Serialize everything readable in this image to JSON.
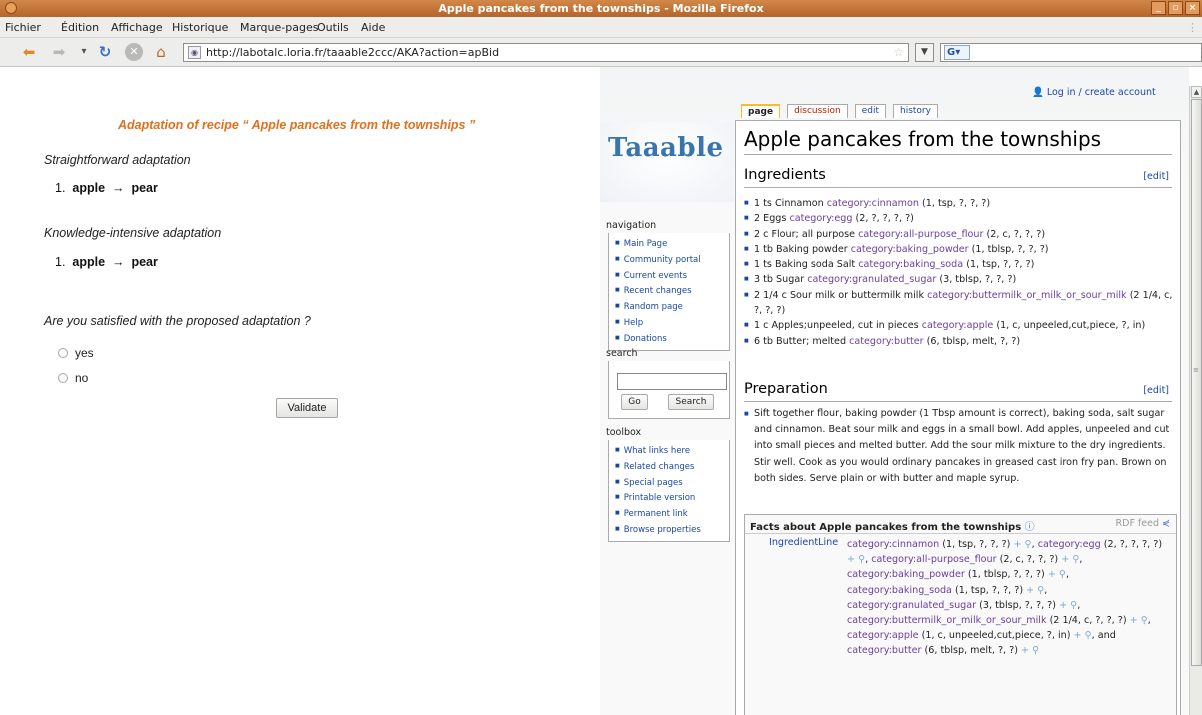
{
  "window": {
    "title": "Apple pancakes from the townships - Mozilla Firefox",
    "min": "_",
    "max": "▫",
    "close": "×"
  },
  "menu": [
    "Fichier",
    "Édition",
    "Affichage",
    "Historique",
    "Marque-pages",
    "Outils",
    "Aide"
  ],
  "nav": {
    "url": "http://labotalc.loria.fr/taaable2ccc/AKA?action=apBid",
    "search_engine": "G",
    "search_value": ""
  },
  "left": {
    "title": "Adaptation of recipe “ Apple pancakes from the townships ”",
    "straightforward_label": "Straightforward adaptation",
    "straightforward_item": {
      "num": "1.",
      "from": "apple",
      "arrow": "→",
      "to": "pear"
    },
    "knowledge_label": "Knowledge-intensive adaptation",
    "knowledge_item": {
      "num": "1.",
      "from": "apple",
      "arrow": "→",
      "to": "pear"
    },
    "question": "Are you satisfied with the proposed adaptation ?",
    "yes": "yes",
    "no": "no",
    "validate": "Validate"
  },
  "wiki": {
    "login": "Log in / create account",
    "tabs": [
      "page",
      "discussion",
      "edit",
      "history"
    ],
    "logo": "Taaable",
    "navigation_label": "navigation",
    "navigation": [
      "Main Page",
      "Community portal",
      "Current events",
      "Recent changes",
      "Random page",
      "Help",
      "Donations"
    ],
    "search_label": "search",
    "go": "Go",
    "search_btn": "Search",
    "toolbox_label": "toolbox",
    "toolbox": [
      "What links here",
      "Related changes",
      "Special pages",
      "Printable version",
      "Permanent link",
      "Browse properties"
    ],
    "page_title": "Apple pancakes from the townships",
    "ingredients_heading": "Ingredients",
    "edit": "[edit]",
    "ingredients": [
      {
        "text": "1 ts Cinnamon",
        "cat": "category:cinnamon",
        "rest": "(1, tsp, ?, ?, ?)"
      },
      {
        "text": "2 Eggs",
        "cat": "category:egg",
        "rest": "(2, ?, ?, ?, ?)"
      },
      {
        "text": "2 c Flour; all purpose",
        "cat": "category:all-purpose_flour",
        "rest": "(2, c, ?, ?, ?)"
      },
      {
        "text": "1 tb Baking powder",
        "cat": "category:baking_powder",
        "rest": "(1, tblsp, ?, ?, ?)"
      },
      {
        "text": "1 ts Baking soda Salt",
        "cat": "category:baking_soda",
        "rest": "(1, tsp, ?, ?, ?)"
      },
      {
        "text": "3 tb Sugar",
        "cat": "category:granulated_sugar",
        "rest": "(3, tblsp, ?, ?, ?)"
      },
      {
        "text": "2 1/4 c Sour milk or buttermilk milk",
        "cat": "category:buttermilk_or_milk_or_sour_milk",
        "rest": "(2 1/4, c, ?, ?, ?)"
      },
      {
        "text": "1 c Apples;unpeeled, cut in pieces",
        "cat": "category:apple",
        "rest": "(1, c, unpeeled,cut,piece, ?, in)"
      },
      {
        "text": "6 tb Butter; melted",
        "cat": "category:butter",
        "rest": "(6, tblsp, melt, ?, ?)"
      }
    ],
    "preparation_heading": "Preparation",
    "preparation": "Sift together flour, baking powder (1 Tbsp amount is correct), baking soda, salt sugar and cinnamon. Beat sour milk and eggs in a small bowl. Add apples, unpeeled and cut into small pieces and melted butter. Add the sour milk mixture to the dry ingredients. Stir well. Cook as you would ordinary pancakes in greased cast iron fry pan. Brown on both sides. Serve plain or with butter and maple syrup.",
    "facts_title": "Facts about Apple pancakes from the townships",
    "rdf": "RDF feed",
    "facts_property": "IngredientLine",
    "facts": [
      {
        "cat": "category:cinnamon",
        "rest": " (1, tsp, ?, ?, ?)"
      },
      {
        "cat": "category:egg",
        "rest": " (2, ?, ?, ?, ?)"
      },
      {
        "cat": "category:all-purpose_flour",
        "rest": " (2, c, ?, ?, ?)"
      },
      {
        "cat": "category:baking_powder",
        "rest": " (1, tblsp, ?, ?, ?)"
      },
      {
        "cat": "category:baking_soda",
        "rest": " (1, tsp, ?, ?, ?)"
      },
      {
        "cat": "category:granulated_sugar",
        "rest": " (3, tblsp, ?, ?, ?)"
      },
      {
        "cat": "category:buttermilk_or_milk_or_sour_milk",
        "rest": " (2 1/4, c, ?, ?, ?)"
      },
      {
        "cat": "category:apple",
        "rest": " (1, c, unpeeled,cut,piece, ?, in)"
      },
      {
        "cat": "category:butter",
        "rest": " (6, tblsp, melt, ?, ?)"
      }
    ],
    "facts_and": "and",
    "plus": "+"
  }
}
